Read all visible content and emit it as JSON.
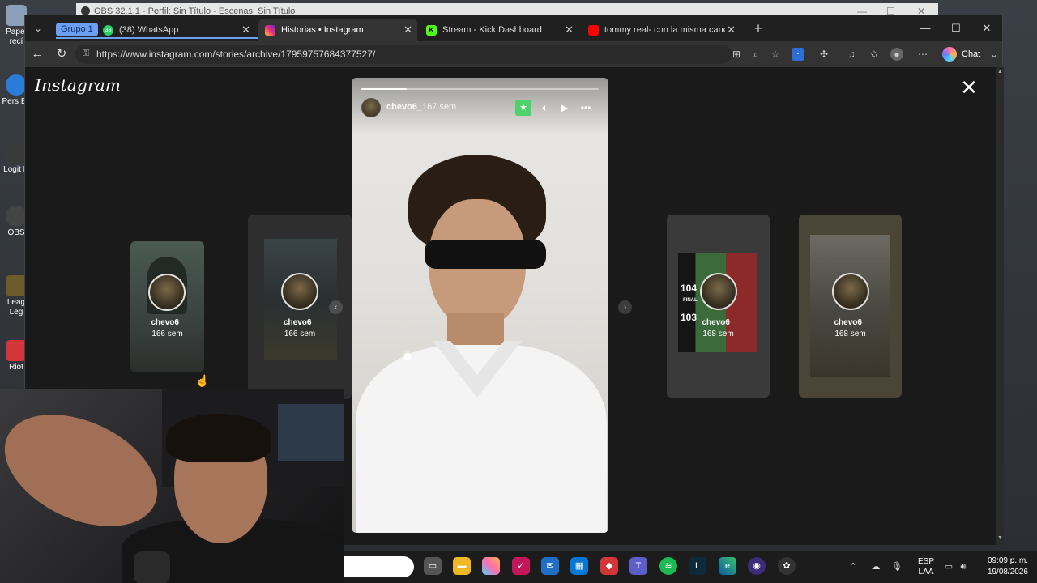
{
  "obs": {
    "title": "OBS 32.1.1 - Perfil: Sin Título - Escenas: Sin Título"
  },
  "desktop": {
    "icons": [
      {
        "label": "Papel recí",
        "color": "#8aa0b8"
      },
      {
        "label": "Pers Ec",
        "color": "#2b7bd8"
      },
      {
        "label": "Logit H",
        "color": "#3a3a3a"
      },
      {
        "label": "OBS",
        "color": "#444"
      },
      {
        "label": "Leag Leg",
        "color": "#6b5a2a"
      },
      {
        "label": "Riot",
        "color": "#d13639"
      }
    ]
  },
  "browser": {
    "group_label": "Grupo 1",
    "tabs": [
      {
        "title": "(38) WhatsApp",
        "badge": "38",
        "color": "#25d366"
      },
      {
        "title": "Historias • Instagram",
        "color": "#d6249f"
      },
      {
        "title": "Stream - Kick Dashboard",
        "badge": "K",
        "color": "#53fc18"
      },
      {
        "title": "tommy real- con la misma cancion",
        "color": "#ff0000"
      }
    ],
    "new_tab": "+",
    "url": "https://www.instagram.com/stories/archive/17959757684377527/",
    "chat_label": "Chat"
  },
  "instagram": {
    "logo": "Instagram",
    "story": {
      "username": "chevo6_",
      "time": "167 sem",
      "progress": 0.19
    },
    "cards": [
      {
        "name": "chevo6_",
        "age": "166 sem"
      },
      {
        "name": "chevo6_",
        "age": "166 sem"
      },
      {
        "name": "chevo6_",
        "age": "168 sem",
        "score_top": "104",
        "score_label": "FINAL",
        "score_bottom": "103"
      },
      {
        "name": "chevo6_",
        "age": "168 sem"
      }
    ]
  },
  "taskbar": {
    "lang_top": "ESP",
    "lang_bottom": "LAA",
    "time": "09:09 p. m.",
    "date": "19/08/2026"
  },
  "colors": {
    "accent_green": "#4ed26a",
    "group_blue": "#6a9ff3"
  }
}
